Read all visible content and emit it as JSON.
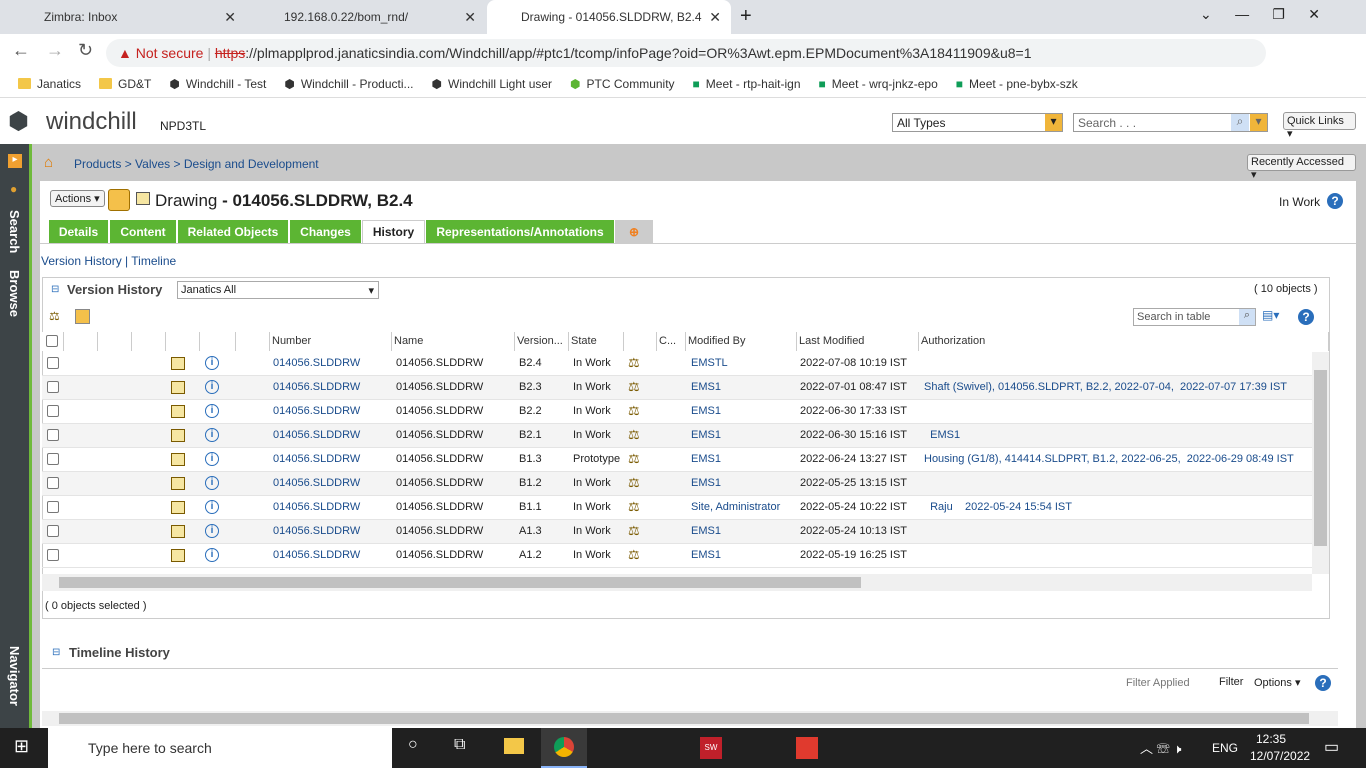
{
  "browser": {
    "tabs": [
      {
        "title": "Zimbra: Inbox"
      },
      {
        "title": "192.168.0.22/bom_rnd/"
      },
      {
        "title": "Drawing - 014056.SLDDRW, B2.4"
      }
    ],
    "security": "Not secure",
    "url_scheme": "https",
    "url_rest": "://plmapplprod.janaticsindia.com/Windchill/app/#ptc1/tcomp/infoPage?oid=OR%3Awt.epm.EPMDocument%3A18411909&u8=1",
    "bookmarks": [
      "Janatics",
      "GD&T",
      "Windchill - Test",
      "Windchill - Producti...",
      "Windchill Light user",
      "PTC Community",
      "Meet - rtp-hait-ign",
      "Meet - wrq-jnkz-epo",
      "Meet - pne-bybx-szk"
    ]
  },
  "app": {
    "logo": "windchill",
    "server": "NPD3TL",
    "type_select": "All Types",
    "search_placeholder": "Search . . .",
    "quick_links": "Quick Links",
    "breadcrumb": [
      "Products",
      "Valves",
      "Design and Development"
    ],
    "recently_accessed": "Recently Accessed",
    "nav": {
      "search": "Search",
      "browse": "Browse",
      "navigator": "Navigator"
    }
  },
  "object": {
    "actions": "Actions",
    "type": "Drawing",
    "title": "- 014056.SLDDRW, B2.4",
    "state": "In Work"
  },
  "tabs": [
    "Details",
    "Content",
    "Related Objects",
    "Changes",
    "History",
    "Representations/Annotations"
  ],
  "subnav": [
    "Version History",
    "Timeline"
  ],
  "version_history": {
    "title": "Version History",
    "view": "Janatics All",
    "count": "( 10 objects )",
    "search_placeholder": "Search in table",
    "selected": "( 0 objects selected )",
    "columns": [
      "Number",
      "Name",
      "Version...",
      "State",
      "C...",
      "Modified By",
      "Last Modified",
      "Authorization"
    ],
    "rows": [
      {
        "number": "014056.SLDDRW",
        "name": "014056.SLDDRW",
        "version": "B2.4",
        "state": "In Work",
        "modified_by": "EMSTL",
        "last_modified": "2022-07-08 10:19 IST",
        "authorization": ""
      },
      {
        "number": "014056.SLDDRW",
        "name": "014056.SLDDRW",
        "version": "B2.3",
        "state": "In Work",
        "modified_by": "EMS1",
        "last_modified": "2022-07-01 08:47 IST",
        "authorization": "Shaft (Swivel), 014056.SLDPRT, B2.2, 2022-07-04,  2022-07-07 17:39 IST"
      },
      {
        "number": "014056.SLDDRW",
        "name": "014056.SLDDRW",
        "version": "B2.2",
        "state": "In Work",
        "modified_by": "EMS1",
        "last_modified": "2022-06-30 17:33 IST",
        "authorization": ""
      },
      {
        "number": "014056.SLDDRW",
        "name": "014056.SLDDRW",
        "version": "B2.1",
        "state": "In Work",
        "modified_by": "EMS1",
        "last_modified": "2022-06-30 15:16 IST",
        "authorization": "  EMS1"
      },
      {
        "number": "014056.SLDDRW",
        "name": "014056.SLDDRW",
        "version": "B1.3",
        "state": "Prototype",
        "modified_by": "EMS1",
        "last_modified": "2022-06-24 13:27 IST",
        "authorization": "Housing (G1/8), 414414.SLDPRT, B1.2, 2022-06-25,  2022-06-29 08:49 IST"
      },
      {
        "number": "014056.SLDDRW",
        "name": "014056.SLDDRW",
        "version": "B1.2",
        "state": "In Work",
        "modified_by": "EMS1",
        "last_modified": "2022-05-25 13:15 IST",
        "authorization": ""
      },
      {
        "number": "014056.SLDDRW",
        "name": "014056.SLDDRW",
        "version": "B1.1",
        "state": "In Work",
        "modified_by": "Site, Administrator",
        "last_modified": "2022-05-24 10:22 IST",
        "authorization": "  Raju    2022-05-24 15:54 IST"
      },
      {
        "number": "014056.SLDDRW",
        "name": "014056.SLDDRW",
        "version": "A1.3",
        "state": "In Work",
        "modified_by": "EMS1",
        "last_modified": "2022-05-24 10:13 IST",
        "authorization": ""
      },
      {
        "number": "014056.SLDDRW",
        "name": "014056.SLDDRW",
        "version": "A1.2",
        "state": "In Work",
        "modified_by": "EMS1",
        "last_modified": "2022-05-19 16:25 IST",
        "authorization": ""
      }
    ]
  },
  "timeline": {
    "title": "Timeline History",
    "filter_applied": "Filter Applied",
    "filter": "Filter",
    "options": "Options"
  },
  "taskbar": {
    "search": "Type here to search",
    "lang": "ENG",
    "time": "12:35",
    "date": "12/07/2022"
  }
}
